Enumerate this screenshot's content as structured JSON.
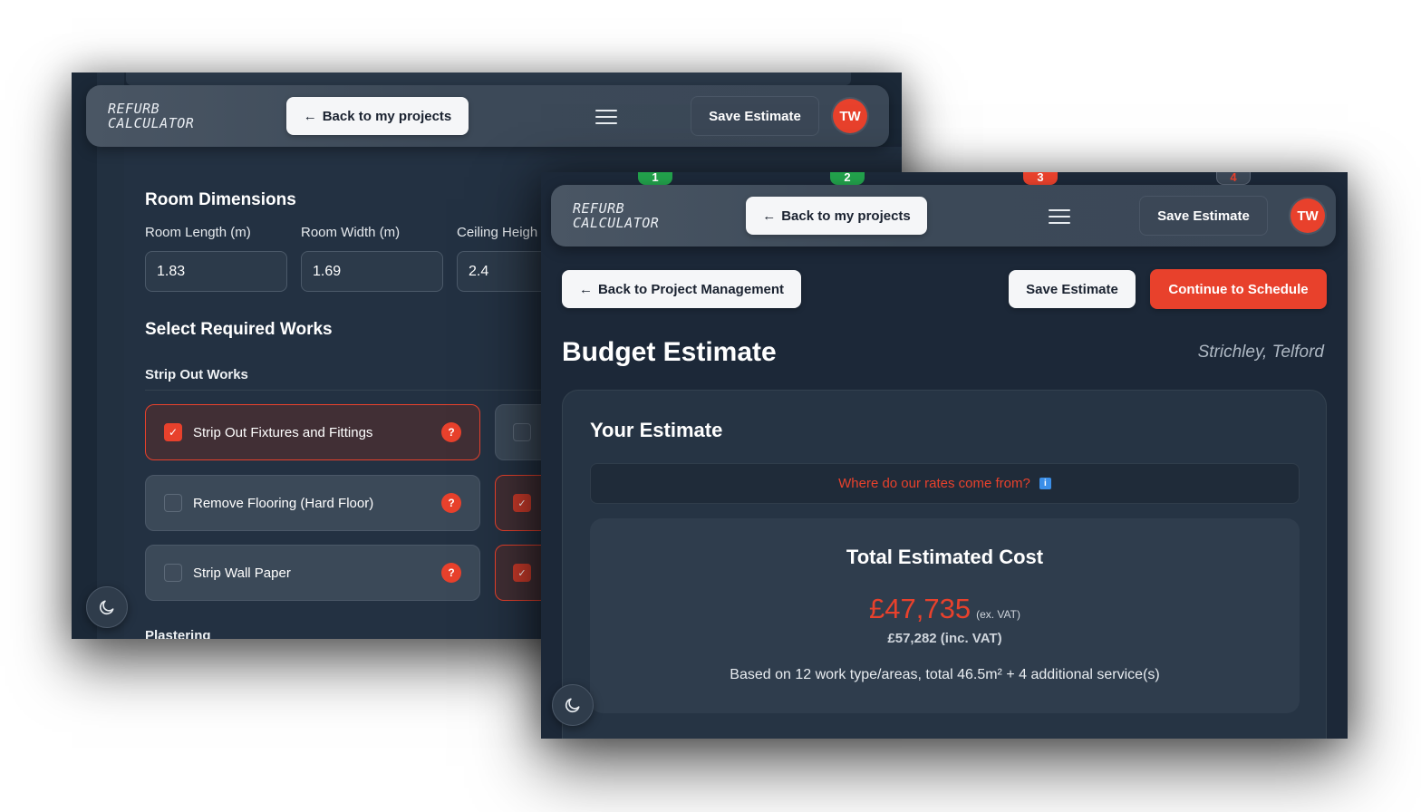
{
  "app": {
    "logo_line1": "REFURB",
    "logo_line2": "CALCULATOR",
    "back_projects_label": "Back to my projects",
    "save_estimate_label": "Save Estimate",
    "avatar_initials": "TW"
  },
  "back_window": {
    "room_dimensions": {
      "heading": "Room Dimensions",
      "fields": [
        {
          "label": "Room Length (m)",
          "value": "1.83"
        },
        {
          "label": "Room Width (m)",
          "value": "1.69"
        },
        {
          "label": "Ceiling Heigh",
          "value": "2.4"
        }
      ]
    },
    "works": {
      "heading": "Select Required Works",
      "group_label": "Strip Out Works",
      "items": [
        {
          "label": "Strip Out Fixtures and Fittings",
          "checked": true
        },
        {
          "label": "Remove Flooring (Hard Floor)",
          "checked": false
        },
        {
          "label": "Strip Wall Paper",
          "checked": false
        }
      ],
      "next_group_label": "Plastering"
    }
  },
  "front_window": {
    "steps": [
      "1",
      "2",
      "3",
      "4"
    ],
    "back_management_label": "Back to Project Management",
    "save_estimate_label": "Save Estimate",
    "continue_label": "Continue to Schedule",
    "page_title": "Budget Estimate",
    "location": "Strichley, Telford",
    "estimate": {
      "title": "Your Estimate",
      "rates_link": "Where do our rates come from?",
      "total_title": "Total Estimated Cost",
      "total_ex_vat": "£47,735",
      "ex_vat_label": "(ex. VAT)",
      "total_inc_vat": "£57,282 (inc. VAT)",
      "basis": "Based on 12 work type/areas, total 46.5m² + 4 additional service(s)"
    }
  },
  "colors": {
    "accent": "#e8412c",
    "step_done": "#22a04b",
    "step_pending": "#3b4756",
    "background": "#1c2838"
  },
  "icons": [
    "arrow-left-icon",
    "hamburger-menu-icon",
    "moon-icon",
    "help-icon",
    "check-icon",
    "info-icon"
  ]
}
